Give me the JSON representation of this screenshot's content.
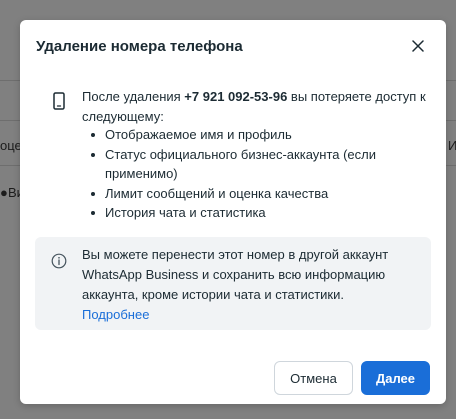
{
  "background": {
    "left_header_fragment": "оцен",
    "right_header_fragment": "И",
    "left_row_fragment": "Ви"
  },
  "dialog": {
    "title": "Удаление номера телефона",
    "close_icon": "close-icon",
    "intro_prefix": "После удаления ",
    "phone_number": "+7 921 092-53-96",
    "intro_suffix": " вы потеряете доступ к следующему:",
    "items": [
      "Отображаемое имя и профиль",
      "Статус официального бизнес-аккаунта (если применимо)",
      "Лимит сообщений и оценка качества",
      "История чата и статистика"
    ],
    "info": {
      "text": "Вы можете перенести этот номер в другой аккаунт WhatsApp Business и сохранить всю информацию аккаунта, кроме истории чата и статистики.",
      "link": "Подробнее"
    },
    "buttons": {
      "cancel": "Отмена",
      "confirm": "Далее"
    }
  },
  "colors": {
    "primary": "#1a6ed8",
    "overlay": "#808080",
    "info_box": "#f1f3f5"
  }
}
